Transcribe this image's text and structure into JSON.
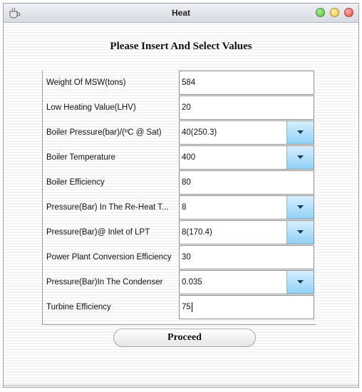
{
  "window": {
    "title": "Heat"
  },
  "heading": "Please Insert And Select Values",
  "fields": [
    {
      "label": "Weight Of MSW(tons)",
      "value": "584",
      "type": "text"
    },
    {
      "label": "Low Heating Value(LHV)",
      "value": "20",
      "type": "text"
    },
    {
      "label": "Boiler Pressure(bar)/(ºC @ Sat)",
      "value": "40(250.3)",
      "type": "dropdown"
    },
    {
      "label": "Boiler Temperature",
      "value": "400",
      "type": "dropdown"
    },
    {
      "label": "Boiler Efficiency",
      "value": "80",
      "type": "text"
    },
    {
      "label": "Pressure(Bar) In The Re-Heat T...",
      "value": "8",
      "type": "dropdown"
    },
    {
      "label": "Pressure(Bar)@ Inlet of LPT",
      "value": "8(170.4)",
      "type": "dropdown"
    },
    {
      "label": "Power Plant Conversion Efficiency",
      "value": "30",
      "type": "text"
    },
    {
      "label": "Pressure(Bar)In The Condenser",
      "value": "0.035",
      "type": "dropdown"
    },
    {
      "label": "Turbine Efficiency",
      "value": "75",
      "type": "text"
    }
  ],
  "proceed_label": "Proceed",
  "colors": {
    "close": "#e8453c",
    "minimize": "#f5c233",
    "maximize": "#4cbf3a",
    "dropdown_accent": "#8fd1f5"
  },
  "icons": {
    "app": "coffee-cup-icon",
    "dropdown": "chevron-down-icon"
  }
}
